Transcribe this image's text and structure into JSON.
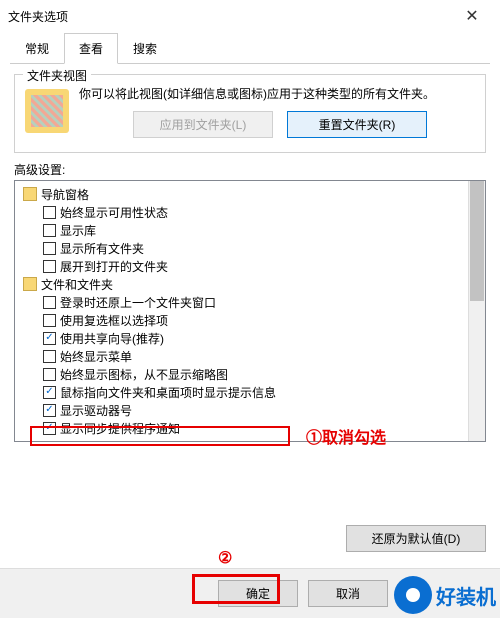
{
  "title": "文件夹选项",
  "tabs": {
    "general": "常规",
    "view": "查看",
    "search": "搜索"
  },
  "group": {
    "label": "文件夹视图",
    "desc": "你可以将此视图(如详细信息或图标)应用于这种类型的所有文件夹。",
    "apply_btn": "应用到文件夹(L)",
    "reset_btn": "重置文件夹(R)"
  },
  "adv_label": "高级设置:",
  "tree": {
    "nav": "导航窗格",
    "i1": "始终显示可用性状态",
    "i2": "显示库",
    "i3": "显示所有文件夹",
    "i4": "展开到打开的文件夹",
    "files": "文件和文件夹",
    "f1": "登录时还原上一个文件夹窗口",
    "f2": "使用复选框以选择项",
    "f3": "使用共享向导(推荐)",
    "f4": "始终显示菜单",
    "f5": "始终显示图标，从不显示缩略图",
    "f6": "鼠标指向文件夹和桌面项时显示提示信息",
    "f7": "显示驱动器号",
    "f8": "显示同步提供程序通知"
  },
  "annotations": {
    "a1": "①取消勾选",
    "a2": "②"
  },
  "restore_btn": "还原为默认值(D)",
  "ok_btn": "确定",
  "cancel_btn": "取消",
  "watermark": "好装机"
}
